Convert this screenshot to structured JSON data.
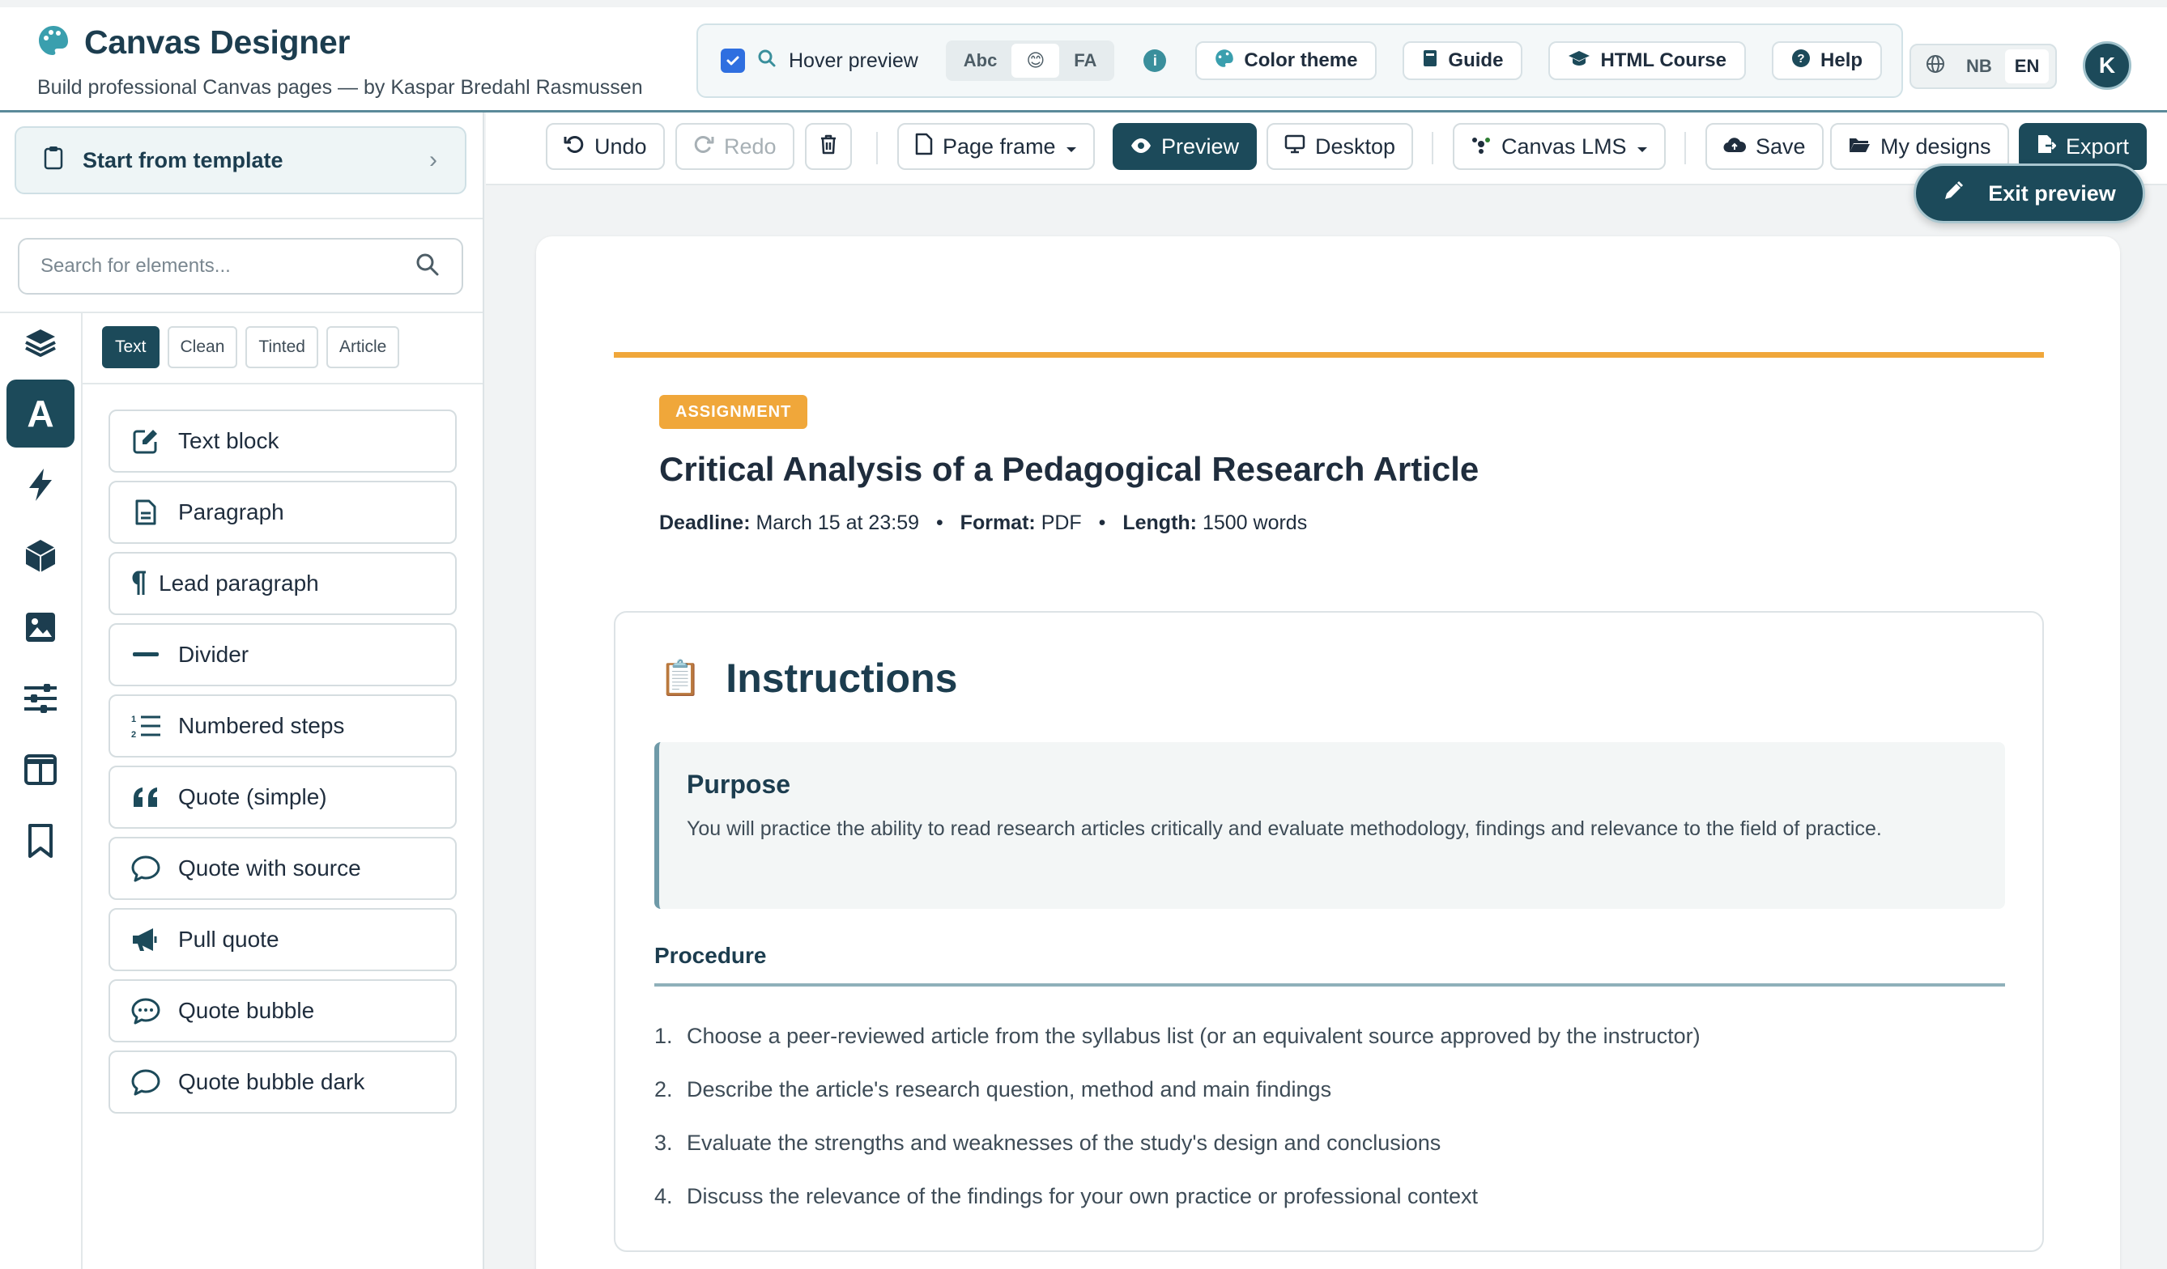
{
  "app": {
    "title": "Canvas Designer",
    "subtitle": "Build professional Canvas pages — by Kaspar Bredahl Rasmussen",
    "icon": "palette-icon"
  },
  "header": {
    "hover_preview_label": "Hover preview",
    "hover_preview_checked": true,
    "icon_set_options": [
      "Abc",
      "😊",
      "FA"
    ],
    "icon_set_selected": "😊",
    "buttons": {
      "color_theme": "Color theme",
      "guide": "Guide",
      "html_course": "HTML Course",
      "help": "Help"
    },
    "languages": [
      "NB",
      "EN"
    ],
    "language_selected": "EN",
    "avatar_initial": "K"
  },
  "sidebar": {
    "template_button": "Start from template",
    "search_placeholder": "Search for elements...",
    "rail": [
      "layers-icon",
      "text-icon",
      "bolt-icon",
      "cube-icon",
      "image-icon",
      "sliders-icon",
      "columns-icon",
      "bookmark-icon"
    ],
    "rail_active": "text-icon",
    "tabs": [
      "Text",
      "Clean",
      "Tinted",
      "Article"
    ],
    "tab_active": "Text",
    "elements": [
      {
        "label": "Text block",
        "icon": "edit-icon"
      },
      {
        "label": "Paragraph",
        "icon": "document-icon"
      },
      {
        "label": "Lead paragraph",
        "icon": "pilcrow-icon"
      },
      {
        "label": "Divider",
        "icon": "minus-icon"
      },
      {
        "label": "Numbered steps",
        "icon": "numbered-list-icon"
      },
      {
        "label": "Quote (simple)",
        "icon": "quote-icon"
      },
      {
        "label": "Quote with source",
        "icon": "speech-bubble-icon"
      },
      {
        "label": "Pull quote",
        "icon": "megaphone-icon"
      },
      {
        "label": "Quote bubble",
        "icon": "chat-dots-icon"
      },
      {
        "label": "Quote bubble dark",
        "icon": "speech-bubble-icon"
      }
    ]
  },
  "toolbar": {
    "undo": "Undo",
    "redo": "Redo",
    "page_frame": "Page frame",
    "preview": "Preview",
    "desktop": "Desktop",
    "canvas_lms": "Canvas LMS",
    "save": "Save",
    "my_designs": "My designs",
    "export": "Export",
    "exit_preview": "Exit preview"
  },
  "document": {
    "badge": "ASSIGNMENT",
    "title": "Critical Analysis of a Pedagogical Research Article",
    "meta": {
      "deadline_label": "Deadline:",
      "deadline_value": "March 15 at 23:59",
      "format_label": "Format:",
      "format_value": "PDF",
      "length_label": "Length:",
      "length_value": "1500 words"
    },
    "instructions": {
      "emoji": "📋",
      "title": "Instructions",
      "purpose_title": "Purpose",
      "purpose_text": "You will practice the ability to read research articles critically and evaluate methodology, findings and relevance to the field of practice.",
      "procedure_title": "Procedure",
      "steps": [
        "Choose a peer-reviewed article from the syllabus list (or an equivalent source approved by the instructor)",
        "Describe the article's research question, method and main findings",
        "Evaluate the strengths and weaknesses of the study's design and conclusions",
        "Discuss the relevance of the findings for your own practice or professional context"
      ]
    }
  },
  "colors": {
    "brand_dark": "#1c4a5a",
    "accent_orange": "#f0a73a",
    "checkbox_blue": "#2f6fe0"
  }
}
